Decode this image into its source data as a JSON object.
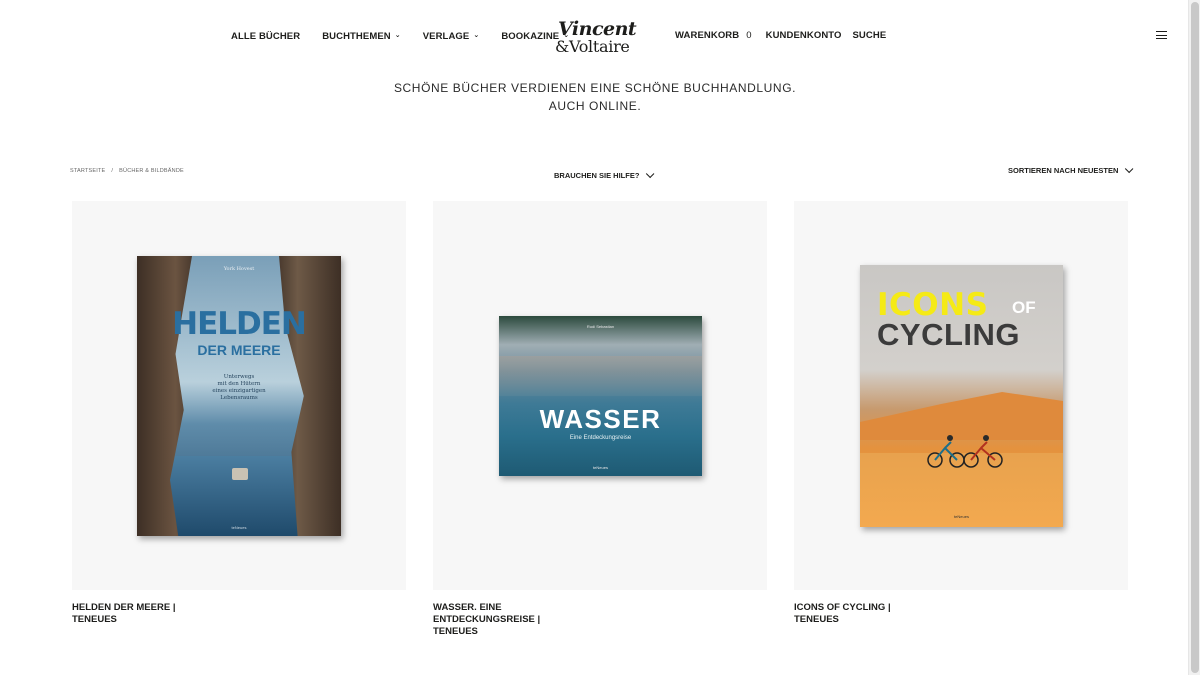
{
  "header": {
    "nav": [
      {
        "label": "ALLE BÜCHER",
        "has_dropdown": false
      },
      {
        "label": "BUCHTHEMEN",
        "has_dropdown": true
      },
      {
        "label": "VERLAGE",
        "has_dropdown": true
      },
      {
        "label": "BOOKAZINE",
        "has_dropdown": true
      }
    ],
    "logo": {
      "line1": "Vincent",
      "line2": "&Voltaire"
    },
    "right": {
      "cart_label": "WARENKORB",
      "cart_count": "0",
      "account_label": "KUNDENKONTO",
      "search_label": "SUCHE"
    },
    "menu_icon": "hamburger-icon"
  },
  "tagline": {
    "line1": "SCHÖNE BÜCHER VERDIENEN EINE SCHÖNE BUCHHANDLUNG.",
    "line2": "AUCH ONLINE."
  },
  "breadcrumb": {
    "home": "STARTSEITE",
    "separator": "/",
    "current": "BÜCHER & BILDBÄNDE"
  },
  "help_label": "BRAUCHEN SIE HILFE?",
  "sort_label": "SORTIEREN NACH NEUESTEN",
  "products": [
    {
      "title_line1": "HELDEN DER MEERE |",
      "title_line2": "TENEUES",
      "cover": {
        "author": "York Hovest",
        "title1": "HELDEN",
        "title2": "DER MEERE",
        "subtitle1": "Unterwegs",
        "subtitle2": "mit den Hütern",
        "subtitle3": "eines einzigartigen",
        "subtitle4": "Lebensraums",
        "publisher": "teNeues"
      }
    },
    {
      "title_line1": "WASSER. EINE",
      "title_line2": "ENTDECKUNGSREISE |",
      "title_line3": "TENEUES",
      "cover": {
        "author": "Rudi Sebastian",
        "title": "WASSER",
        "subtitle": "Eine Entdeckungsreise",
        "publisher": "teNeues"
      }
    },
    {
      "title_line1": "ICONS OF CYCLING |",
      "title_line2": "TENEUES",
      "cover": {
        "word1": "ICONS",
        "word2": "OF",
        "word3": "CYCLING",
        "publisher": "teNeues"
      }
    }
  ],
  "colors": {
    "tile_background": "#f7f7f7",
    "text": "#1d1d1b",
    "icons_yellow": "#f5ea16"
  }
}
